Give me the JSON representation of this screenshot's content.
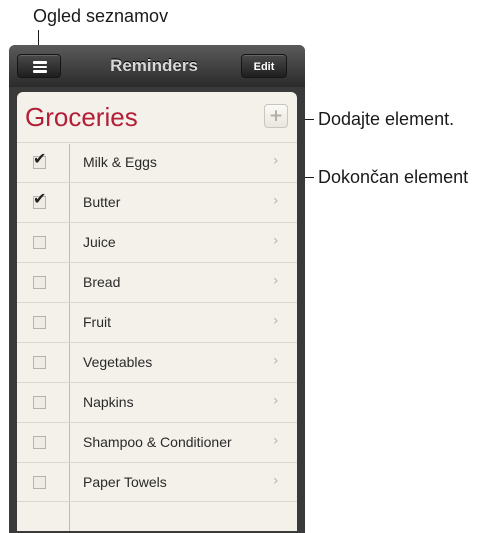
{
  "callouts": {
    "list_view": "Ogled seznamov",
    "add_item": "Dodajte element.",
    "completed_item": "Dokončan element"
  },
  "navbar": {
    "title": "Reminders",
    "menu_icon": "hamburger-menu-icon",
    "edit_label": "Edit"
  },
  "list": {
    "title": "Groceries",
    "add_icon": "plus-icon",
    "title_color": "#b21f36",
    "items": [
      {
        "label": "Milk & Eggs",
        "checked": true
      },
      {
        "label": "Butter",
        "checked": true
      },
      {
        "label": "Juice",
        "checked": false
      },
      {
        "label": "Bread",
        "checked": false
      },
      {
        "label": "Fruit",
        "checked": false
      },
      {
        "label": "Vegetables",
        "checked": false
      },
      {
        "label": "Napkins",
        "checked": false
      },
      {
        "label": "Shampoo & Conditioner",
        "checked": false
      },
      {
        "label": "Paper Towels",
        "checked": false
      }
    ]
  }
}
